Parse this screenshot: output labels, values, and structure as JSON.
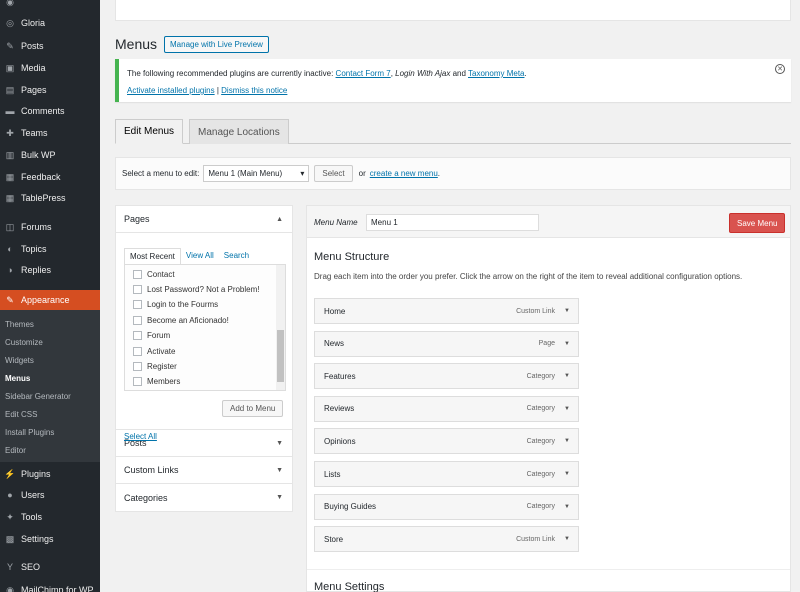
{
  "sidebar": {
    "items": [
      {
        "label": "",
        "icon": "dashboard-icon",
        "glyph": "◉"
      },
      {
        "label": "Gloria",
        "icon": "gloria-icon",
        "glyph": "◎"
      },
      {
        "label": "Posts",
        "icon": "pin-icon",
        "glyph": "✎"
      },
      {
        "label": "Media",
        "icon": "media-icon",
        "glyph": "▣"
      },
      {
        "label": "Pages",
        "icon": "pages-icon",
        "glyph": "▤"
      },
      {
        "label": "Comments",
        "icon": "comments-icon",
        "glyph": "▬"
      },
      {
        "label": "Teams",
        "icon": "plus-icon",
        "glyph": "✚"
      },
      {
        "label": "Bulk WP",
        "icon": "trash-icon",
        "glyph": "▥"
      },
      {
        "label": "Feedback",
        "icon": "feedback-icon",
        "glyph": "▦"
      },
      {
        "label": "TablePress",
        "icon": "table-icon",
        "glyph": "▦"
      },
      {
        "label": "Forums",
        "icon": "forums-icon",
        "glyph": "◫"
      },
      {
        "label": "Topics",
        "icon": "topics-icon",
        "glyph": "◐"
      },
      {
        "label": "Replies",
        "icon": "replies-icon",
        "glyph": "◑"
      },
      {
        "label": "Appearance",
        "icon": "appearance-icon",
        "glyph": "✎"
      }
    ],
    "submenu": [
      "Themes",
      "Customize",
      "Widgets",
      "Menus",
      "Sidebar Generator",
      "Edit CSS",
      "Install Plugins",
      "Editor"
    ],
    "bottom_items": [
      {
        "label": "Plugins",
        "icon": "plugins-icon",
        "glyph": "⚡"
      },
      {
        "label": "Users",
        "icon": "users-icon",
        "glyph": "●"
      },
      {
        "label": "Tools",
        "icon": "tools-icon",
        "glyph": "✦"
      },
      {
        "label": "Settings",
        "icon": "settings-icon",
        "glyph": "▩"
      },
      {
        "label": "SEO",
        "icon": "seo-icon",
        "glyph": "Y"
      },
      {
        "label": "MailChimp for WP",
        "icon": "mailchimp-icon",
        "glyph": "◉"
      }
    ]
  },
  "page": {
    "title": "Menus",
    "live_preview": "Manage with Live Preview"
  },
  "notice": {
    "text_before": "The following recommended plugins are currently inactive: ",
    "plugin1": "Contact Form 7",
    "sep1": ", ",
    "plugin2": "Login With Ajax",
    "and": " and ",
    "plugin3": "Taxonomy Meta",
    "end": ".",
    "activate": "Activate installed plugins",
    "pipe": " | ",
    "dismiss": "Dismiss this notice"
  },
  "tabs": {
    "edit": "Edit Menus",
    "manage": "Manage Locations"
  },
  "select_bar": {
    "label": "Select a menu to edit:",
    "selected": "Menu 1 (Main Menu)",
    "select_btn": "Select",
    "or": "or",
    "create_link": "create a new menu",
    "period": "."
  },
  "left_panel": {
    "pages_title": "Pages",
    "subtabs": [
      "Most Recent",
      "View All",
      "Search"
    ],
    "pages": [
      "Contact",
      "Lost Password? Not a Problem!",
      "Login to the Fourms",
      "Become an Aficionado!",
      "Forum",
      "Activate",
      "Register",
      "Members"
    ],
    "select_all": "Select All",
    "add_to_menu": "Add to Menu",
    "sections": [
      "Posts",
      "Custom Links",
      "Categories"
    ]
  },
  "menu": {
    "name_label": "Menu Name",
    "name_value": "Menu 1",
    "save": "Save Menu",
    "structure_title": "Menu Structure",
    "structure_desc": "Drag each item into the order you prefer. Click the arrow on the right of the item to reveal additional configuration options.",
    "items": [
      {
        "title": "Home",
        "type": "Custom Link"
      },
      {
        "title": "News",
        "type": "Page"
      },
      {
        "title": "Features",
        "type": "Category"
      },
      {
        "title": "Reviews",
        "type": "Category"
      },
      {
        "title": "Opinions",
        "type": "Category"
      },
      {
        "title": "Lists",
        "type": "Category"
      },
      {
        "title": "Buying Guides",
        "type": "Category"
      },
      {
        "title": "Store",
        "type": "Custom Link"
      }
    ],
    "settings_title": "Menu Settings"
  },
  "colors": {
    "sidebar_bg": "#23282d",
    "accent": "#d54e21",
    "link": "#0073aa",
    "notice_border": "#46b450",
    "save_bg": "#d9534f"
  }
}
